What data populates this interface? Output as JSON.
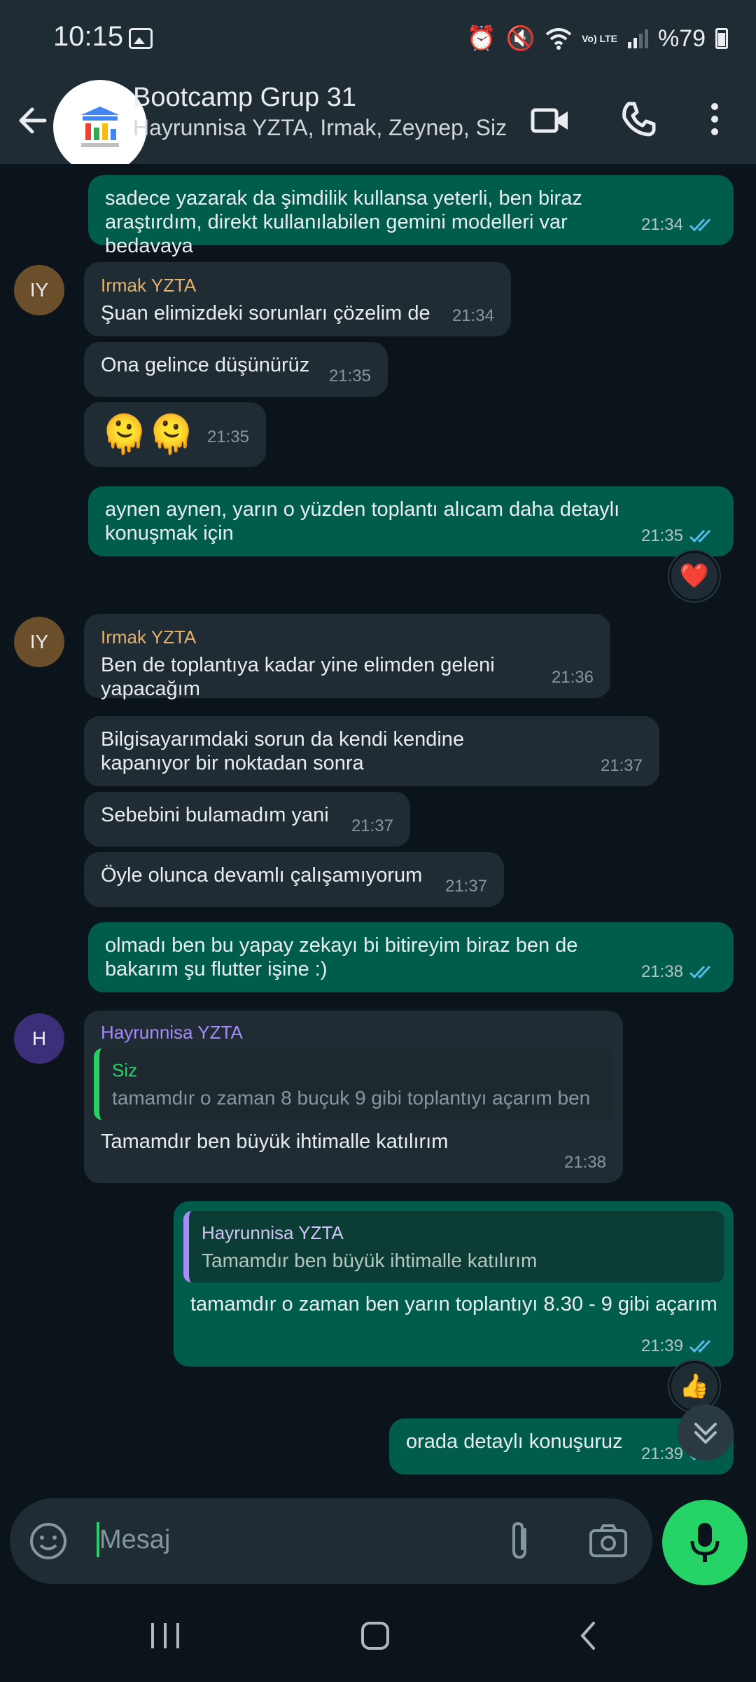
{
  "status_bar": {
    "time": "10:15",
    "network": "Vo) LTE",
    "battery": "%79"
  },
  "header": {
    "title": "Bootcamp Grup 31",
    "subtitle": "Hayrunnisa YZTA, Irmak, Zeynep, Siz"
  },
  "messages": [
    {
      "text": "sadece yazarak da şimdilik kullansa yeterli, ben biraz araştırdım, direkt kullanılabilen gemini modelleri var bedavaya",
      "time": "21:34"
    },
    {
      "sender": "Irmak YZTA",
      "avatar": "IY",
      "text": "Şuan elimizdeki sorunları çözelim de",
      "time": "21:34"
    },
    {
      "text": "Ona gelince düşünürüz",
      "time": "21:35"
    },
    {
      "text": "🫠🫠",
      "time": "21:35"
    },
    {
      "text": "aynen aynen, yarın o yüzden toplantı alıcam daha detaylı konuşmak için",
      "time": "21:35",
      "reaction": "❤️"
    },
    {
      "sender": "Irmak YZTA",
      "avatar": "IY",
      "text": "Ben de toplantıya kadar yine elimden geleni yapacağım",
      "time": "21:36"
    },
    {
      "text": "Bilgisayarımdaki sorun da kendi kendine kapanıyor bir noktadan sonra",
      "time": "21:37"
    },
    {
      "text": "Sebebini bulamadım yani",
      "time": "21:37"
    },
    {
      "text": "Öyle olunca devamlı çalışamıyorum",
      "time": "21:37"
    },
    {
      "text": "olmadı ben bu yapay zekayı bi bitireyim biraz ben de bakarım şu flutter işine :)",
      "time": "21:38"
    },
    {
      "sender": "Hayrunnisa YZTA",
      "avatar": "H",
      "quote_name": "Siz",
      "quote_text": "tamamdır o zaman 8 buçuk 9 gibi toplantıyı açarım ben",
      "text": "Tamamdır ben büyük ihtimalle katılırım",
      "time": "21:38"
    },
    {
      "quote_name": "Hayrunnisa YZTA",
      "quote_text": "Tamamdır ben büyük ihtimalle katılırım",
      "text": "tamamdır o zaman ben yarın toplantıyı 8.30 - 9 gibi açarım",
      "time": "21:39",
      "reaction": "👍"
    },
    {
      "text": "orada detaylı konuşuruz",
      "time": "21:39"
    }
  ],
  "input": {
    "placeholder": "Mesaj"
  },
  "colors": {
    "outgoing": "#005c4b",
    "incoming": "#1f2c34",
    "accent": "#25d366",
    "background": "#0b141a",
    "irmak": "#e5b16b",
    "hayrunnisa": "#a78bfa",
    "read_ticks": "#53bdeb"
  },
  "icons": [
    "back-arrow-icon",
    "video-call-icon",
    "phone-icon",
    "more-vert-icon",
    "sticker-icon",
    "attach-icon",
    "camera-icon",
    "mic-icon",
    "scroll-down-icon",
    "gallery-icon",
    "alarm-icon",
    "mute-icon",
    "wifi-icon",
    "signal-icon",
    "battery-icon"
  ]
}
